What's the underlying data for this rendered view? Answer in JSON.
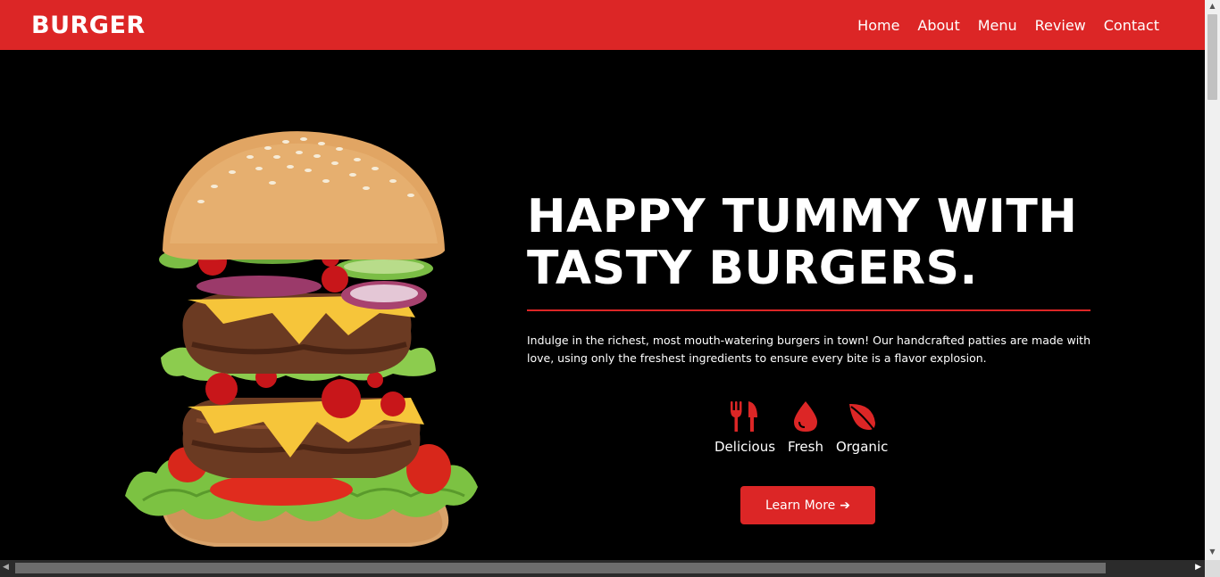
{
  "brand": "BURGER",
  "nav": {
    "items": [
      {
        "label": "Home"
      },
      {
        "label": "About"
      },
      {
        "label": "Menu"
      },
      {
        "label": "Review"
      },
      {
        "label": "Contact"
      }
    ]
  },
  "hero": {
    "headline_line1": "HAPPY TUMMY WITH",
    "headline_line2": "TASTY BURGERS.",
    "description": "Indulge in the richest, most mouth-watering burgers in town! Our handcrafted patties are made with love, using only the freshest ingredients to ensure every bite is a flavor explosion.",
    "features": [
      {
        "label": "Delicious",
        "icon": "utensils-icon"
      },
      {
        "label": "Fresh",
        "icon": "droplet-icon"
      },
      {
        "label": "Organic",
        "icon": "leaf-icon"
      }
    ],
    "cta_label": "Learn More",
    "cta_icon": "arrow-right-icon"
  },
  "colors": {
    "accent": "#dc2626",
    "background": "#000000",
    "text": "#ffffff"
  }
}
